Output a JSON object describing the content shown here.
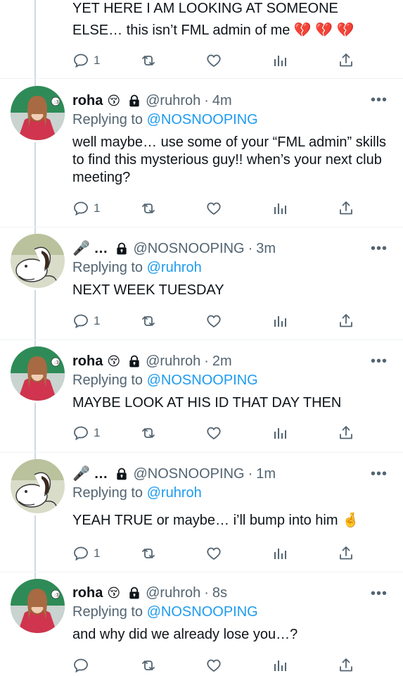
{
  "tweets": [
    {
      "text": "YET HERE I AM LOOKING AT SOMEONE ELSE… this isn’t FML admin of me 💔 💔 💔",
      "reply_count": "1"
    },
    {
      "name": "roha",
      "emoji": "😚",
      "handle": "@ruhroh",
      "time": "4m",
      "replying_prefix": "Replying to",
      "replying_to": "@NOSNOOPING",
      "text": "well maybe… use some of your “FML admin” skills to find this mysterious guy!! when’s your next club meeting?",
      "reply_count": "1"
    },
    {
      "name": "🎤 …",
      "emoji": "",
      "handle": "@NOSNOOPING",
      "time": "3m",
      "replying_prefix": "Replying to",
      "replying_to": "@ruhroh",
      "text": "NEXT WEEK TUESDAY",
      "reply_count": "1"
    },
    {
      "name": "roha",
      "emoji": "😚",
      "handle": "@ruhroh",
      "time": "2m",
      "replying_prefix": "Replying to",
      "replying_to": "@NOSNOOPING",
      "text": "MAYBE LOOK AT HIS ID THAT DAY THEN",
      "reply_count": "1"
    },
    {
      "name": "🎤 …",
      "emoji": "",
      "handle": "@NOSNOOPING",
      "time": "1m",
      "replying_prefix": "Replying to",
      "replying_to": "@ruhroh",
      "text": "YEAH TRUE or maybe… i’ll bump into him 🤞",
      "reply_count": "1"
    },
    {
      "name": "roha",
      "emoji": "😚",
      "handle": "@ruhroh",
      "time": "8s",
      "replying_prefix": "Replying to",
      "replying_to": "@NOSNOOPING",
      "text": "and why did we already lose you…?",
      "reply_count": ""
    }
  ],
  "ui": {
    "separator": "·",
    "more_label": "•••"
  },
  "icons": {
    "reply": "reply-icon",
    "retweet": "retweet-icon",
    "like": "heart-icon",
    "views": "views-icon",
    "share": "share-icon",
    "lock": "lock-icon",
    "more": "more-icon"
  },
  "colors": {
    "text": "#0f1419",
    "secondary": "#536471",
    "link": "#1d9bf0",
    "thread_line": "#cfd9de",
    "divider": "#eff3f4"
  }
}
